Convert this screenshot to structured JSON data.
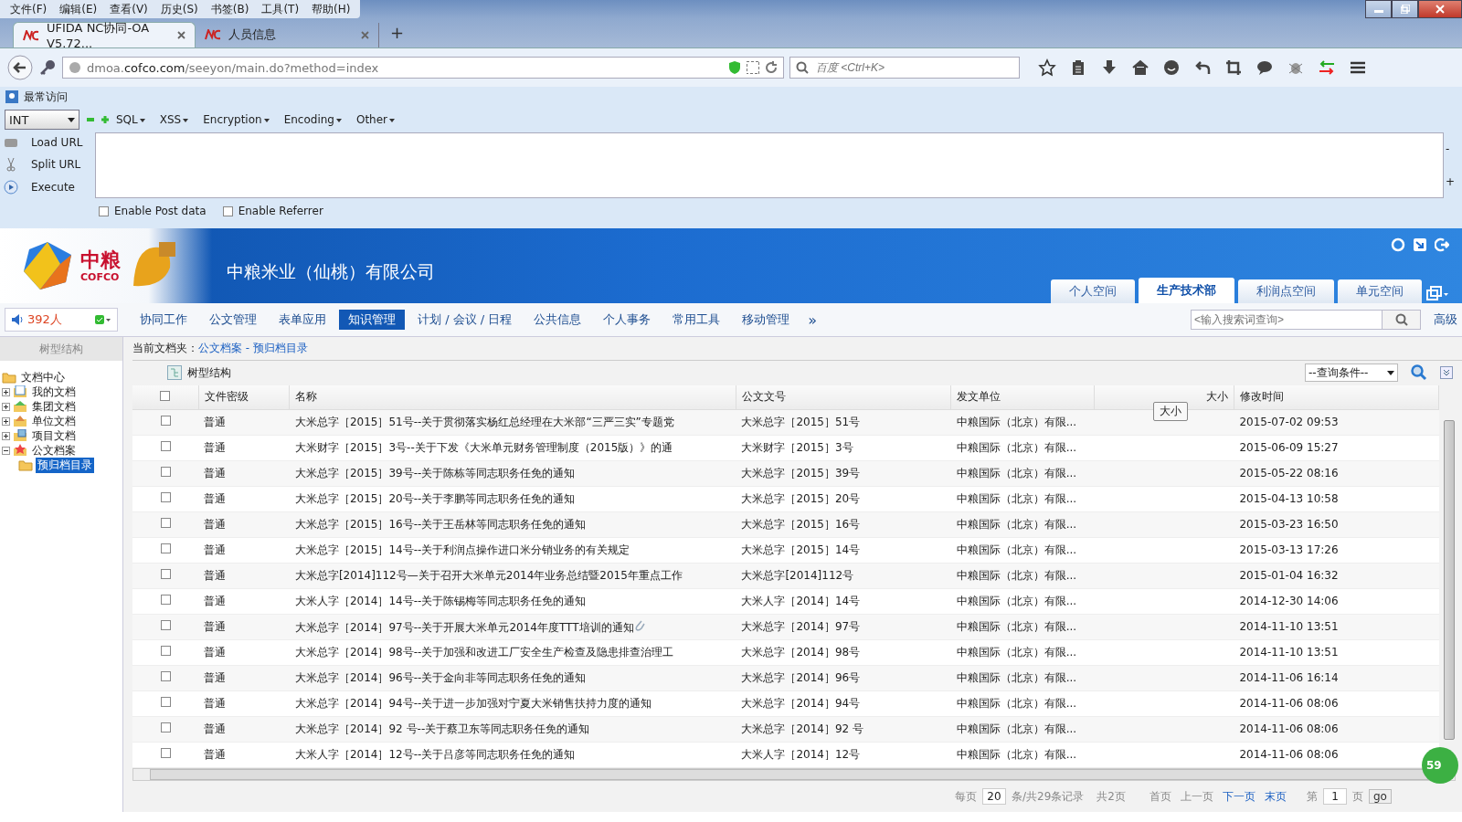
{
  "menu_bar": [
    "文件(F)",
    "编辑(E)",
    "查看(V)",
    "历史(S)",
    "书签(B)",
    "工具(T)",
    "帮助(H)"
  ],
  "browser_tabs": [
    {
      "title": "UFIDA NC协同-OA V5.72...",
      "selected": true
    },
    {
      "title": "人员信息",
      "selected": false
    }
  ],
  "new_tab": "+",
  "address": "dmoa.**cofco.com**/seeyon/main.do?method=index",
  "search": {
    "placeholder": "百度 <Ctrl+K>"
  },
  "bookmarks": [
    "最常访问"
  ],
  "hackbar": {
    "select": "INT",
    "menus": [
      "SQL",
      "XSS",
      "Encryption",
      "Encoding",
      "Other"
    ],
    "actions": [
      "Load URL",
      "Split URL",
      "Execute"
    ],
    "checkboxes": [
      {
        "label": "Enable Post data",
        "checked": false
      },
      {
        "label": "Enable Referrer",
        "checked": false
      }
    ],
    "side": [
      "-",
      "+"
    ]
  },
  "app": {
    "logo": [
      "中粮",
      "COFCO"
    ],
    "company": "中粮米业（仙桃）有限公司",
    "space_tabs": [
      {
        "label": "个人空间",
        "selected": false
      },
      {
        "label": "生产技术部",
        "selected": true
      },
      {
        "label": "利润点空间",
        "selected": false
      },
      {
        "label": "单元空间",
        "selected": false
      }
    ],
    "online": "392人",
    "nav": [
      {
        "label": "协同工作",
        "selected": false
      },
      {
        "label": "公文管理",
        "selected": false
      },
      {
        "label": "表单应用",
        "selected": false
      },
      {
        "label": "知识管理",
        "selected": true
      },
      {
        "label": "计划 / 会议 / 日程",
        "selected": false
      },
      {
        "label": "公共信息",
        "selected": false
      },
      {
        "label": "个人事务",
        "selected": false
      },
      {
        "label": "常用工具",
        "selected": false
      },
      {
        "label": "移动管理",
        "selected": false
      }
    ],
    "nav_more": "»",
    "search": {
      "placeholder": "<输入搜索词查询>"
    },
    "advanced": "高级"
  },
  "sidebar": {
    "title": "树型结构",
    "root": {
      "label": "文档中心",
      "children": [
        {
          "label": "我的文档",
          "kind": "doc",
          "expanded": false,
          "selected": false
        },
        {
          "label": "集团文档",
          "kind": "group",
          "expanded": false,
          "selected": false
        },
        {
          "label": "单位文档",
          "kind": "unit",
          "expanded": false,
          "selected": false
        },
        {
          "label": "项目文档",
          "kind": "project",
          "expanded": false,
          "selected": false
        },
        {
          "label": "公文档案",
          "kind": "archive",
          "expanded": true,
          "selected": false,
          "children": [
            {
              "label": "预归档目录",
              "kind": "folder",
              "selected": true
            }
          ]
        }
      ]
    }
  },
  "breadcrumb": {
    "label": "当前文档夹：",
    "path": [
      "公文档案",
      "预归档目录"
    ],
    "separator": " - "
  },
  "toolbar": {
    "tree_button": "树型结构",
    "query": "--查询条件--"
  },
  "table": {
    "columns": [
      "文件密级",
      "名称",
      "公文文号",
      "发文单位",
      "大小",
      "修改时间"
    ],
    "header_checked": false,
    "tooltip": "大小",
    "rows": [
      {
        "checked": false,
        "level": "普通",
        "name": "大米总字［2015］51号--关于贯彻落实杨红总经理在大米部“三严三实”专题党",
        "number": "大米总字［2015］51号",
        "unit": "中粮国际（北京）有限...",
        "time": "2015-07-02 09:53",
        "attachment": false
      },
      {
        "checked": false,
        "level": "普通",
        "name": "大米财字［2015］3号--关于下发《大米单元财务管理制度（2015版）》的通",
        "number": "大米财字［2015］3号",
        "unit": "中粮国际（北京）有限...",
        "time": "2015-06-09 15:27",
        "attachment": false
      },
      {
        "checked": false,
        "level": "普通",
        "name": "大米总字［2015］39号--关于陈栋等同志职务任免的通知",
        "number": "大米总字［2015］39号",
        "unit": "中粮国际（北京）有限...",
        "time": "2015-05-22 08:16",
        "attachment": false
      },
      {
        "checked": false,
        "level": "普通",
        "name": "大米总字［2015］20号--关于李鹏等同志职务任免的通知",
        "number": "大米总字［2015］20号",
        "unit": "中粮国际（北京）有限...",
        "time": "2015-04-13 10:58",
        "attachment": false
      },
      {
        "checked": false,
        "level": "普通",
        "name": "大米总字［2015］16号--关于王岳林等同志职务任免的通知",
        "number": "大米总字［2015］16号",
        "unit": "中粮国际（北京）有限...",
        "time": "2015-03-23 16:50",
        "attachment": false
      },
      {
        "checked": false,
        "level": "普通",
        "name": "大米总字［2015］14号--关于利润点操作进口米分销业务的有关规定",
        "number": "大米总字［2015］14号",
        "unit": "中粮国际（北京）有限...",
        "time": "2015-03-13 17:26",
        "attachment": false
      },
      {
        "checked": false,
        "level": "普通",
        "name": "大米总字[2014]112号—关于召开大米单元2014年业务总结暨2015年重点工作",
        "number": "大米总字[2014]112号",
        "unit": "中粮国际（北京）有限...",
        "time": "2015-01-04 16:32",
        "attachment": false
      },
      {
        "checked": false,
        "level": "普通",
        "name": "大米人字［2014］14号--关于陈锡梅等同志职务任免的通知",
        "number": "大米人字［2014］14号",
        "unit": "中粮国际（北京）有限...",
        "time": "2014-12-30 14:06",
        "attachment": false
      },
      {
        "checked": false,
        "level": "普通",
        "name": "大米总字［2014］97号--关于开展大米单元2014年度TTT培训的通知",
        "number": "大米总字［2014］97号",
        "unit": "中粮国际（北京）有限...",
        "time": "2014-11-10 13:51",
        "attachment": true
      },
      {
        "checked": false,
        "level": "普通",
        "name": "大米总字［2014］98号--关于加强和改进工厂安全生产检查及隐患排查治理工",
        "number": "大米总字［2014］98号",
        "unit": "中粮国际（北京）有限...",
        "time": "2014-11-10 13:51",
        "attachment": false
      },
      {
        "checked": false,
        "level": "普通",
        "name": "大米总字［2014］96号--关于金向非等同志职务任免的通知",
        "number": "大米总字［2014］96号",
        "unit": "中粮国际（北京）有限...",
        "time": "2014-11-06 16:14",
        "attachment": false
      },
      {
        "checked": false,
        "level": "普通",
        "name": "大米总字［2014］94号--关于进一步加强对宁夏大米销售扶持力度的通知",
        "number": "大米总字［2014］94号",
        "unit": "中粮国际（北京）有限...",
        "time": "2014-11-06 08:06",
        "attachment": false
      },
      {
        "checked": false,
        "level": "普通",
        "name": "大米总字［2014］92 号--关于蔡卫东等同志职务任免的通知",
        "number": "大米总字［2014］92 号",
        "unit": "中粮国际（北京）有限...",
        "time": "2014-11-06 08:06",
        "attachment": false
      },
      {
        "checked": false,
        "level": "普通",
        "name": "大米人字［2014］12号--关于吕彦等同志职务任免的通知",
        "number": "大米人字［2014］12号",
        "unit": "中粮国际（北京）有限...",
        "time": "2014-11-06 08:06",
        "attachment": false
      }
    ]
  },
  "pager": {
    "per_page_label": "每页",
    "per_page": "20",
    "records": "条/共29条记录",
    "pages": "共2页",
    "links": [
      "首页",
      "上一页",
      "下一页",
      "末页"
    ],
    "page_label": "第",
    "page": "1",
    "page_unit": "页",
    "go": "go"
  },
  "badge": "59"
}
